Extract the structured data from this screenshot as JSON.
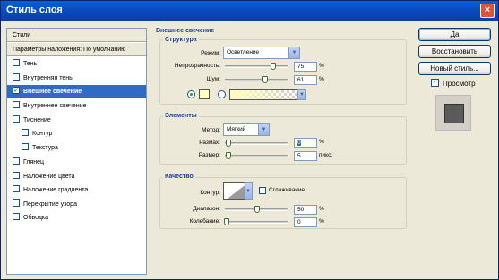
{
  "window": {
    "title": "Стиль слоя",
    "close": "×"
  },
  "left_panel": {
    "items": [
      {
        "label": "Стили",
        "header": true
      },
      {
        "label": "Параметры наложения: По умолчанию",
        "header": true
      },
      {
        "label": "Тень",
        "checked": false
      },
      {
        "label": "Внутренняя тень",
        "checked": false
      },
      {
        "label": "Внешнее свечение",
        "checked": true,
        "selected": true
      },
      {
        "label": "Внутреннее свечение",
        "checked": false
      },
      {
        "label": "Тиснение",
        "checked": false
      },
      {
        "label": "Контур",
        "checked": false,
        "indent": true
      },
      {
        "label": "Текстура",
        "checked": false,
        "indent": true
      },
      {
        "label": "Глянец",
        "checked": false
      },
      {
        "label": "Наложение цвета",
        "checked": false
      },
      {
        "label": "Наложение градиента",
        "checked": false
      },
      {
        "label": "Перекрытие узора",
        "checked": false
      },
      {
        "label": "Обводка",
        "checked": false
      }
    ]
  },
  "main": {
    "section_title": "Внешнее свечение",
    "structure": {
      "title": "Структура",
      "mode_label": "Режим:",
      "mode_value": "Осветление",
      "opacity_label": "Непрозрачность:",
      "opacity_value": "75",
      "noise_label": "Шум:",
      "noise_value": "61",
      "unit": "%",
      "glow_color": "#ffffbe"
    },
    "elements": {
      "title": "Элементы",
      "method_label": "Метод:",
      "method_value": "Мягкий",
      "spread_label": "Размах:",
      "spread_value": "0",
      "size_label": "Размер:",
      "size_value": "5",
      "unit_percent": "%",
      "unit_px": "пикс."
    },
    "quality": {
      "title": "Качество",
      "contour_label": "Контур:",
      "antialias_label": "Сглаживание",
      "range_label": "Диапазон:",
      "range_value": "50",
      "jitter_label": "Колебание:",
      "jitter_value": "0",
      "unit": "%"
    }
  },
  "buttons": {
    "ok": "Да",
    "reset": "Восстановить",
    "new_style": "Новый стиль...",
    "preview_label": "Просмотр"
  }
}
